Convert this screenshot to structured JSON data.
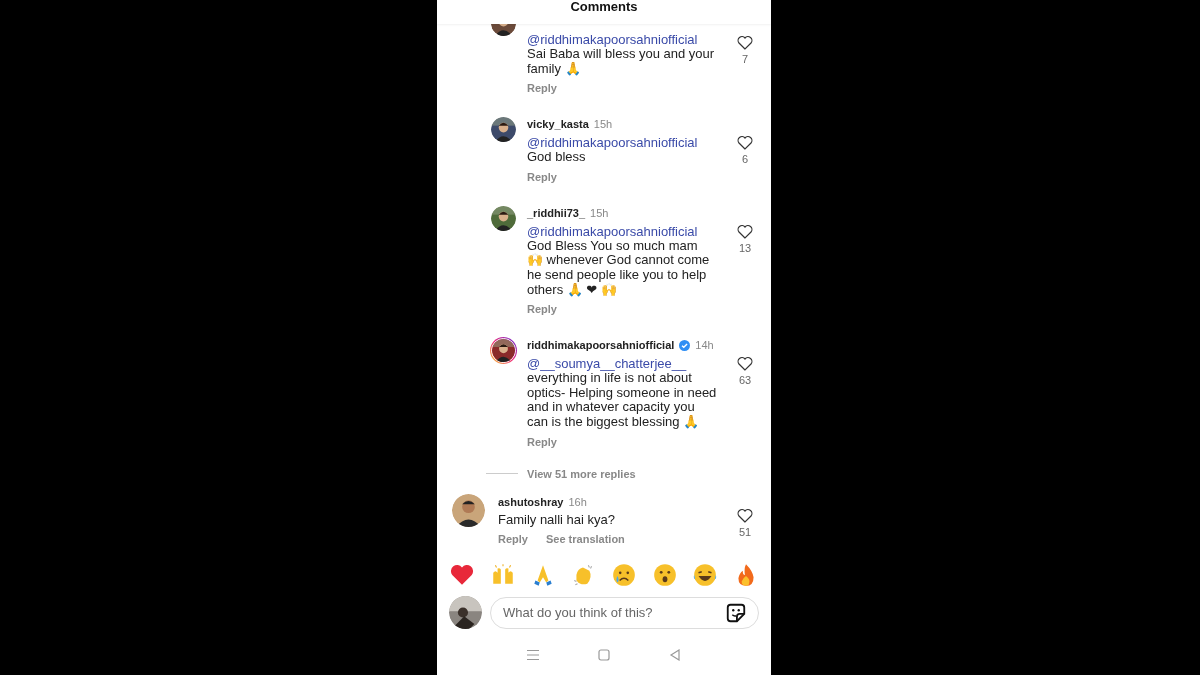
{
  "header": {
    "title": "Comments"
  },
  "replies": [
    {
      "mention": "@riddhimakapoorsahniofficial",
      "text": "Sai Baba will bless you and your family 🙏",
      "likes": "7",
      "reply": "Reply",
      "avatar_ring": false
    },
    {
      "username": "vicky_kasta",
      "verified": false,
      "time": "15h",
      "mention": "@riddhimakapoorsahniofficial",
      "text": "God bless",
      "likes": "6",
      "reply": "Reply",
      "avatar_ring": false
    },
    {
      "username": "_riddhii73_",
      "verified": false,
      "time": "15h",
      "mention": "@riddhimakapoorsahniofficial",
      "text": "God Bless You so much mam 🙌 whenever God cannot come he send people like you to help others 🙏 ❤ 🙌",
      "likes": "13",
      "reply": "Reply",
      "avatar_ring": false
    },
    {
      "username": "riddhimakapoorsahniofficial",
      "verified": true,
      "time": "14h",
      "mention": "@__soumya__chatterjee__",
      "text": "everything in life is not  about optics- Helping someone in need and in whatever capacity you can is the biggest blessing 🙏",
      "likes": "63",
      "reply": "Reply",
      "avatar_ring": true
    }
  ],
  "view_more_replies": "View 51 more replies",
  "comments": [
    {
      "username": "ashutoshray",
      "time": "16h",
      "text": "Family nalli hai kya?",
      "likes": "51",
      "actions": [
        "Reply",
        "See translation"
      ]
    }
  ],
  "composer": {
    "placeholder": "What do you think of this?"
  }
}
